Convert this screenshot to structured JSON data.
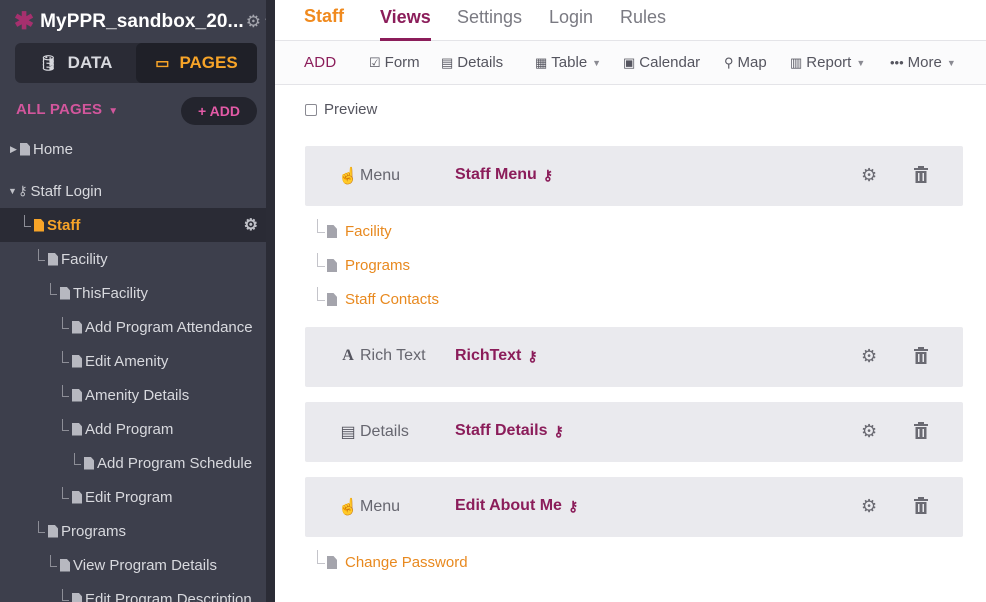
{
  "app": {
    "name": "MyPPR_sandbox_20...",
    "logo_icon": "asterisk-logo",
    "accent": "#a6306e"
  },
  "mode_toggle": {
    "data_label": "DATA",
    "pages_label": "PAGES",
    "active": "PAGES"
  },
  "sidebar": {
    "all_pages_label": "ALL PAGES",
    "add_label": "+ ADD",
    "tree": [
      {
        "label": "Home"
      },
      {
        "label": "Staff Login"
      },
      {
        "label": "Staff"
      },
      {
        "label": "Facility"
      },
      {
        "label": "ThisFacility"
      },
      {
        "label": "Add Program Attendance"
      },
      {
        "label": "Edit Amenity"
      },
      {
        "label": "Amenity Details"
      },
      {
        "label": "Add Program"
      },
      {
        "label": "Add Program Schedule"
      },
      {
        "label": "Edit Program"
      },
      {
        "label": "Programs"
      },
      {
        "label": "View Program Details"
      },
      {
        "label": "Edit Program Description"
      }
    ]
  },
  "header": {
    "page_name": "Staff",
    "tabs": [
      {
        "label": "Views"
      },
      {
        "label": "Settings"
      },
      {
        "label": "Login"
      },
      {
        "label": "Rules"
      }
    ],
    "active_tab": "Views"
  },
  "toolbar": {
    "add_label": "ADD",
    "items": [
      {
        "label": "Form",
        "icon": "form-check-icon"
      },
      {
        "label": "Details",
        "icon": "details-icon"
      },
      {
        "label": "Table",
        "icon": "table-icon"
      },
      {
        "label": "Calendar",
        "icon": "calendar-icon"
      },
      {
        "label": "Map",
        "icon": "map-marker-icon"
      },
      {
        "label": "Report",
        "icon": "bar-chart-icon"
      },
      {
        "label": "More",
        "icon": "ellipsis-icon"
      }
    ]
  },
  "preview_label": "Preview",
  "views": [
    {
      "type": "Menu",
      "name": "Staff Menu",
      "icon": "hand-pointer-icon",
      "links": [
        "Facility",
        "Programs",
        "Staff Contacts"
      ]
    },
    {
      "type": "Rich Text",
      "name": "RichText",
      "icon": "font-icon",
      "links": []
    },
    {
      "type": "Details",
      "name": "Staff Details",
      "icon": "details-icon",
      "links": []
    },
    {
      "type": "Menu",
      "name": "Edit About Me",
      "icon": "hand-pointer-icon",
      "links": [
        "Change Password"
      ]
    }
  ],
  "colors": {
    "brand": "#8b1d5a",
    "active_page": "#f7a428",
    "link_orange": "#e8891f",
    "sidebar_bg": "#3d3f4c"
  }
}
